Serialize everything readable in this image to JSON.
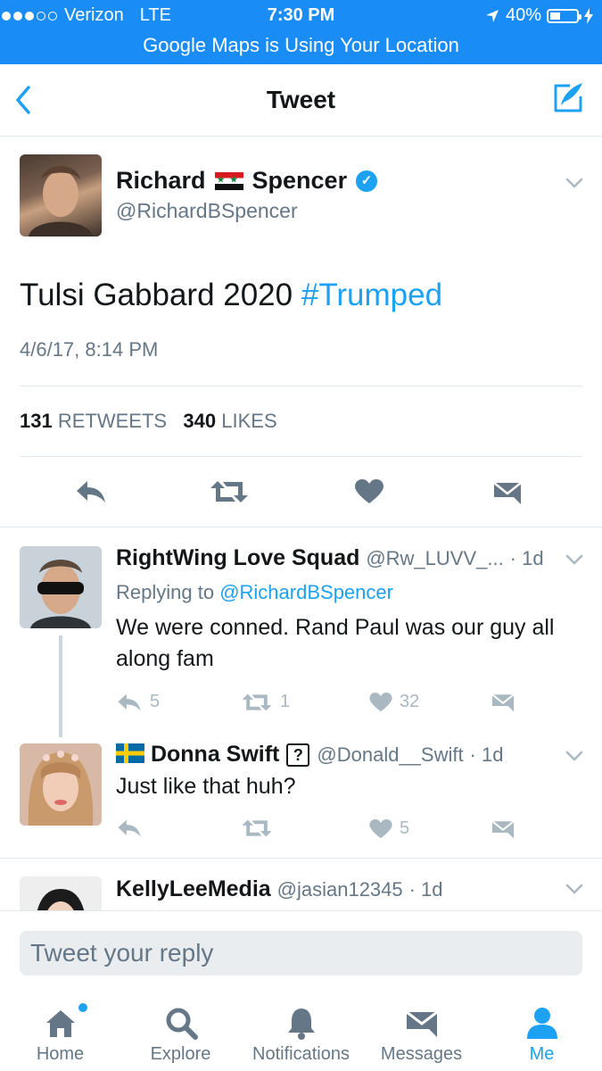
{
  "status_bar": {
    "carrier": "Verizon",
    "network": "LTE",
    "time": "7:30 PM",
    "battery": "40%",
    "battery_level": 0.4,
    "banner": "Google Maps is Using Your Location"
  },
  "nav": {
    "title": "Tweet"
  },
  "main_tweet": {
    "name_first": "Richard",
    "name_last": "Spencer",
    "handle": "@RichardBSpencer",
    "text": "Tulsi Gabbard 2020",
    "hashtag": "#Trumped",
    "timestamp": "4/6/17, 8:14 PM",
    "retweets_count": "131",
    "retweets_label": "RETWEETS",
    "likes_count": "340",
    "likes_label": "LIKES"
  },
  "replies": [
    {
      "name": "RightWing Love Squad",
      "handle": "@Rw_LUVV_...",
      "time": "· 1d",
      "replying_prefix": "Replying to",
      "replying_to": "@RichardBSpencer",
      "text": "We were conned. Rand Paul was our guy all along fam",
      "reply_count": "5",
      "retweet_count": "1",
      "like_count": "32"
    },
    {
      "name": "Donna Swift",
      "handle": "@Donald__Swift",
      "time": "· 1d",
      "text": "Just like that huh?",
      "reply_count": "",
      "retweet_count": "",
      "like_count": "5"
    },
    {
      "name": "KellyLeeMedia",
      "handle": "@jasian12345",
      "time": "· 1d"
    }
  ],
  "composer": {
    "placeholder": "Tweet your reply"
  },
  "tabs": [
    {
      "label": "Home",
      "icon": "home-icon"
    },
    {
      "label": "Explore",
      "icon": "search-icon"
    },
    {
      "label": "Notifications",
      "icon": "bell-icon"
    },
    {
      "label": "Messages",
      "icon": "envelope-icon"
    },
    {
      "label": "Me",
      "icon": "person-icon"
    }
  ],
  "colors": {
    "accent": "#1da1f2",
    "status_bar": "#1a8cf5",
    "muted": "#657786",
    "icon_gray": "#aab8c2"
  }
}
